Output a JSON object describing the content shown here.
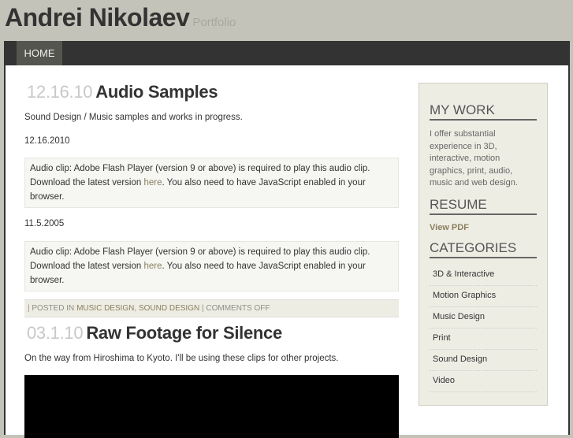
{
  "header": {
    "title": "Andrei Nikolaev",
    "tagline": "Portfolio"
  },
  "nav": {
    "home": "HOME"
  },
  "posts": [
    {
      "date": "12.16.10",
      "title": "Audio Samples",
      "intro": "Sound Design / Music samples and works in progress.",
      "entries": [
        {
          "date": "12.16.2010",
          "clip_a": "Audio clip: Adobe Flash Player (version 9 or above) is required to play this audio clip. Download the latest version ",
          "link": "here",
          "clip_b": ". You also need to have JavaScript enabled in your browser."
        },
        {
          "date": "11.5.2005",
          "clip_a": "Audio clip: Adobe Flash Player (version 9 or above) is required to play this audio clip. Download the latest version ",
          "link": "here",
          "clip_b": ". You also need to have JavaScript enabled in your browser."
        }
      ],
      "meta": {
        "prefix": "| POSTED IN ",
        "cat1": "MUSIC DESIGN",
        "sep": ", ",
        "cat2": "SOUND DESIGN",
        "suffix": " | COMMENTS OFF"
      }
    },
    {
      "date": "03.1.10",
      "title": "Raw Footage for Silence",
      "intro": "On the way from Hiroshima to Kyoto. I'll be using these clips for other projects."
    }
  ],
  "sidebar": {
    "mywork_title": "MY WORK",
    "mywork_text": "I offer substantial experience in 3D, interactive, motion graphics, print, audio, music and web design.",
    "resume_title": "RESUME",
    "resume_link": "View PDF",
    "categories_title": "CATEGORIES",
    "categories": [
      "3D & Interactive",
      "Motion Graphics",
      "Music Design",
      "Print",
      "Sound Design",
      "Video"
    ]
  }
}
